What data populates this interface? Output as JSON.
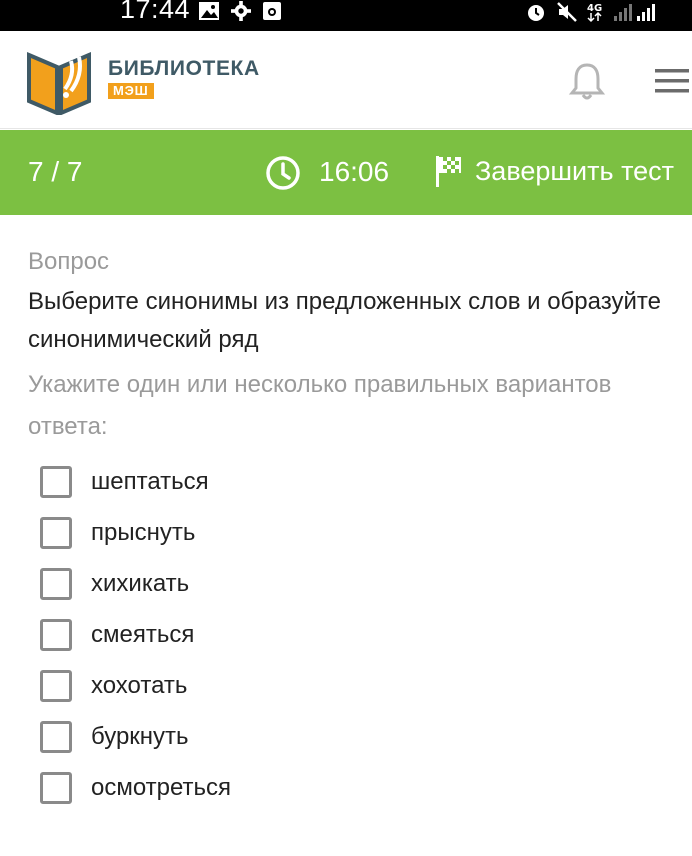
{
  "status_bar": {
    "time": "17:44"
  },
  "header": {
    "logo_title": "БИБЛИОТЕКА",
    "logo_subtitle": "МЭШ",
    "brand_colors": {
      "orange": "#f2a01c",
      "slate": "#3f5a66",
      "green": "#7cc042"
    }
  },
  "test_bar": {
    "progress": "7 / 7",
    "timer": "16:06",
    "finish_label": "Завершить тест"
  },
  "question": {
    "label": "Вопрос",
    "text": "Выберите синонимы из предложенных слов и образуйте синонимический ряд",
    "hint": "Укажите один или несколько правильных вариантов ответа:",
    "options": [
      {
        "label": "шептаться",
        "checked": false
      },
      {
        "label": "прыснуть",
        "checked": false
      },
      {
        "label": "хихикать",
        "checked": false
      },
      {
        "label": "смеяться",
        "checked": false
      },
      {
        "label": "хохотать",
        "checked": false
      },
      {
        "label": "буркнуть",
        "checked": false
      },
      {
        "label": "осмотреться",
        "checked": false
      }
    ]
  },
  "icons": [
    "image-icon",
    "settings-icon",
    "photo-icon",
    "alarm-icon",
    "mute-icon",
    "network-4g-icon",
    "signal-icon",
    "bell-icon",
    "hamburger-menu-icon",
    "clock-icon",
    "finish-flag-icon"
  ]
}
